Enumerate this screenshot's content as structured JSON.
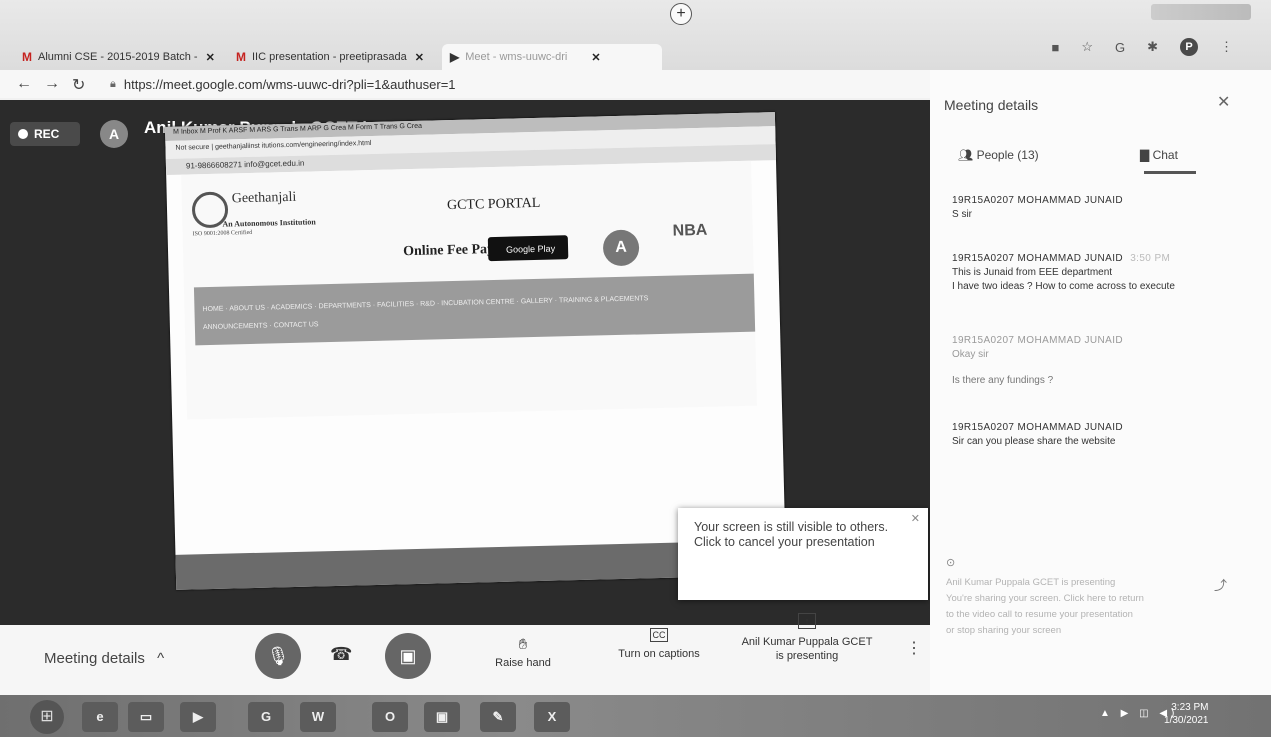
{
  "browser": {
    "tabs": [
      {
        "label": "Alumni CSE - 2015-2019 Batch -",
        "favicon": "M"
      },
      {
        "label": "IIC presentation - preetiprasada",
        "favicon": "M"
      },
      {
        "label": "Meet - wms-uuwc-dri",
        "favicon": "meet"
      }
    ],
    "url": "https://meet.google.com/wms-uuwc-dri?pli=1&authuser=1",
    "profile_initial": "P"
  },
  "meeting": {
    "rec_label": "REC",
    "presenter_initial": "A",
    "presenting_text": "Anil Kumar Puppala GCET is presenting",
    "popover_text": "Your screen is still visible to others. Click to cancel your presentation"
  },
  "shared_screen": {
    "tabs_text": "M Inbox  M Prof  K ARSF  M ARS  G Trans  M ARP  G Crea  M Form  T Trans  G Crea",
    "address": "Not secure | geethanjaliinst itutions.com/engineering/index.html",
    "contact": "91-9866608271   info@gcet.edu.in",
    "college_name": "Geethanjali",
    "college_tag": "An Autonomous Institution",
    "college_cert": "ISO 9001:2008 Certified",
    "portal": "GCTC PORTAL",
    "fee": "Online Fee Payment",
    "gplay": "Google Play",
    "naac": "A",
    "nba": "NBA",
    "nav_line1": "HOME · ABOUT US · ACADEMICS · DEPARTMENTS · FACILITIES · R&D · INCUBATION CENTRE · GALLERY · TRAINING & PLACEMENTS",
    "nav_line2": "ANNOUNCEMENTS · CONTACT US"
  },
  "bottom_bar": {
    "meeting_details": "Meeting details",
    "raise_hand": "Raise hand",
    "captions": "Turn on captions",
    "presenting_line1": "Anil Kumar Puppala GCET",
    "presenting_line2": "is presenting"
  },
  "panel": {
    "title": "Meeting details",
    "people_tab": "People (13)",
    "chat_tab": "Chat",
    "messages": [
      {
        "sender": "19R15A0207 MOHAMMAD JUNAID",
        "time": "",
        "lines": [
          "S sir"
        ],
        "faint": false
      },
      {
        "sender": "19R15A0207 MOHAMMAD JUNAID",
        "time": "3:50 PM",
        "lines": [
          "This is Junaid from EEE department",
          "I have two ideas ? How to come across to execute"
        ],
        "faint": false
      },
      {
        "sender": "19R15A0207 MOHAMMAD JUNAID",
        "time": "",
        "lines": [
          "Okay sir",
          "Is there any fundings ?"
        ],
        "faint": true
      },
      {
        "sender": "19R15A0207 MOHAMMAD JUNAID",
        "time": "",
        "lines": [
          "Sir can you please share the website"
        ],
        "faint": false
      }
    ],
    "note_lines": [
      "Anil Kumar Puppala GCET is presenting",
      "You're sharing your screen. Click here to return",
      "to the video call to resume your presentation",
      "or stop sharing your screen"
    ]
  },
  "taskbar": {
    "time": "3:23 PM",
    "date": "1/30/2021"
  }
}
